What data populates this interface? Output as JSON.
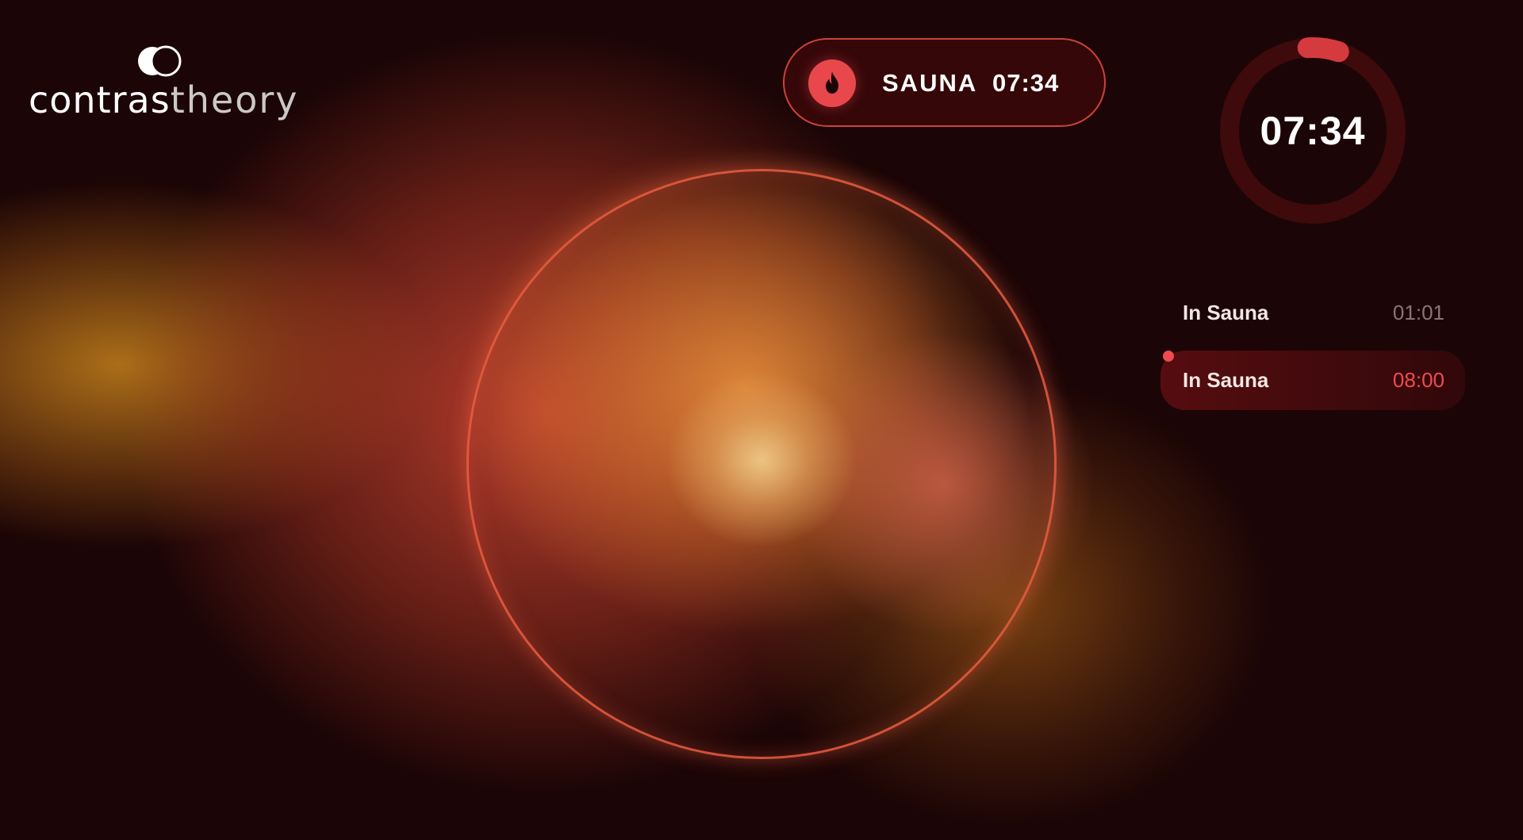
{
  "brand": {
    "name_part1": "contras",
    "name_part2": "theory",
    "mark_icon": "overlapping-circles-icon"
  },
  "status": {
    "label": "SAUNA",
    "time": "07:34",
    "icon": "flame-icon",
    "accent": "#e8484c"
  },
  "timer": {
    "time": "07:34",
    "progress": 0.06,
    "track_color": "#3e0a0c",
    "progress_color": "#d53b3e"
  },
  "phases": [
    {
      "label": "In Sauna",
      "time": "01:01",
      "active": false
    },
    {
      "label": "In Sauna",
      "time": "08:00",
      "active": true
    }
  ],
  "colors": {
    "background": "#1c0506",
    "ring": "#e85c40",
    "active_time": "#ef4b4f",
    "inactive_time": "#8a7574"
  }
}
